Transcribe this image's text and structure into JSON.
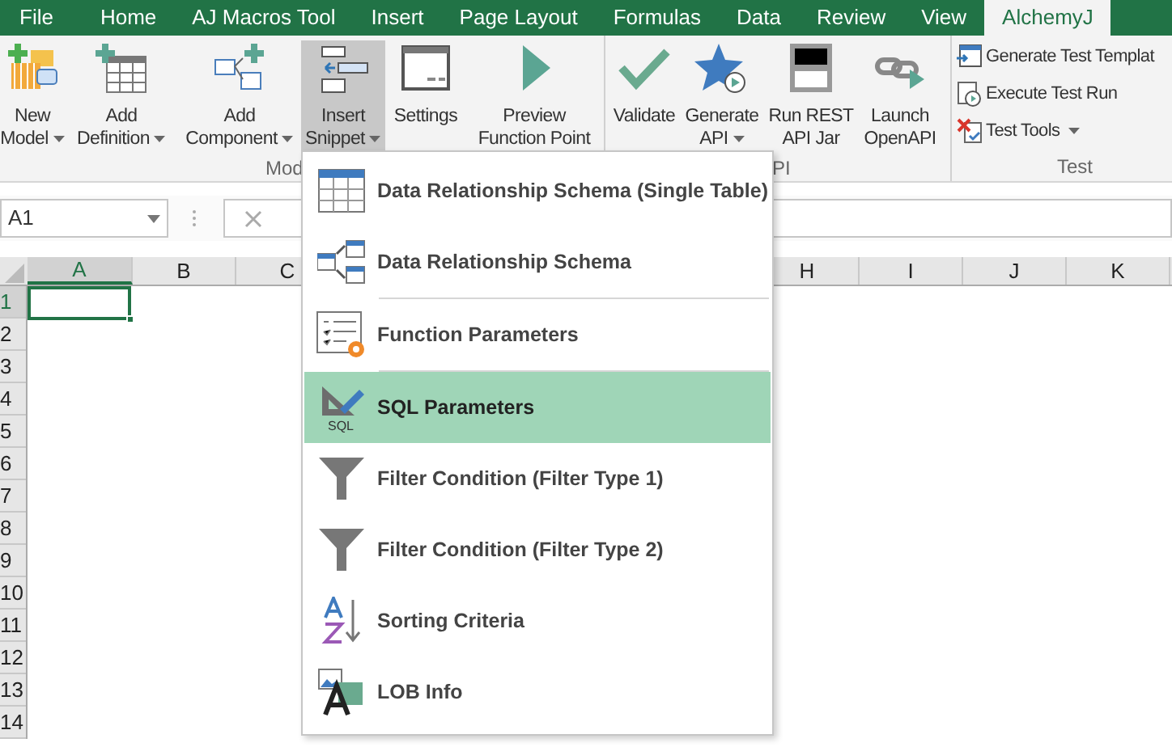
{
  "ribbon_tabs": [
    {
      "label": "File",
      "selected": false
    },
    {
      "label": "Home",
      "selected": false
    },
    {
      "label": "AJ Macros Tool",
      "selected": false
    },
    {
      "label": "Insert",
      "selected": false
    },
    {
      "label": "Page Layout",
      "selected": false
    },
    {
      "label": "Formulas",
      "selected": false
    },
    {
      "label": "Data",
      "selected": false
    },
    {
      "label": "Review",
      "selected": false
    },
    {
      "label": "View",
      "selected": false
    },
    {
      "label": "AlchemyJ",
      "selected": true
    }
  ],
  "ribbon_groups": [
    {
      "label": "Mod",
      "buttons": [
        {
          "line1": "New",
          "line2": "Model",
          "dropdown": true,
          "pressed": false
        },
        {
          "line1": "Add",
          "line2": "Definition",
          "dropdown": true,
          "pressed": false
        },
        {
          "line1": "Add",
          "line2": "Component",
          "dropdown": true,
          "pressed": false
        },
        {
          "line1": "Insert",
          "line2": "Snippet",
          "dropdown": true,
          "pressed": true
        },
        {
          "line1": "Settings",
          "dropdown": false,
          "pressed": false
        },
        {
          "line1": "Preview",
          "line2": "Function Point",
          "dropdown": false,
          "pressed": false
        }
      ]
    },
    {
      "label": "PI",
      "buttons": [
        {
          "line1": "Validate",
          "dropdown": false,
          "pressed": false
        },
        {
          "line1": "Generate",
          "line2": "API",
          "dropdown": true,
          "pressed": false
        },
        {
          "line1": "Run REST",
          "line2": "API Jar",
          "dropdown": false,
          "pressed": false
        },
        {
          "line1": "Launch",
          "line2": "OpenAPI",
          "dropdown": false,
          "pressed": false
        }
      ]
    },
    {
      "label": "Test",
      "small_buttons": [
        {
          "label": "Generate Test Templat",
          "dropdown": false
        },
        {
          "label": "Execute Test Run",
          "dropdown": false
        },
        {
          "label": "Test Tools",
          "dropdown": true
        }
      ]
    }
  ],
  "name_box": "A1",
  "columns": [
    {
      "label": "A",
      "selected": true
    },
    {
      "label": "B",
      "selected": false
    },
    {
      "label": "C",
      "selected": false
    },
    {
      "label": "H",
      "selected": false
    },
    {
      "label": "I",
      "selected": false
    },
    {
      "label": "J",
      "selected": false
    },
    {
      "label": "K",
      "selected": false
    }
  ],
  "rows": [
    {
      "label": "1",
      "selected": true
    },
    {
      "label": "2",
      "selected": false
    },
    {
      "label": "3",
      "selected": false
    },
    {
      "label": "4",
      "selected": false
    },
    {
      "label": "5",
      "selected": false
    },
    {
      "label": "6",
      "selected": false
    },
    {
      "label": "7",
      "selected": false
    },
    {
      "label": "8",
      "selected": false
    },
    {
      "label": "9",
      "selected": false
    },
    {
      "label": "10",
      "selected": false
    },
    {
      "label": "11",
      "selected": false
    },
    {
      "label": "12",
      "selected": false
    },
    {
      "label": "13",
      "selected": false
    },
    {
      "label": "14",
      "selected": false
    }
  ],
  "snippet_menu": [
    {
      "label": "Data Relationship Schema (Single Table)",
      "selected": false,
      "divider_before": false
    },
    {
      "label": "Data Relationship Schema",
      "selected": false,
      "divider_before": false
    },
    {
      "label": "Function Parameters",
      "selected": false,
      "divider_before": true
    },
    {
      "label": "SQL Parameters",
      "selected": true,
      "divider_before": true,
      "icon_caption": "SQL"
    },
    {
      "label": "Filter Condition (Filter Type 1)",
      "selected": false,
      "divider_before": false
    },
    {
      "label": "Filter Condition (Filter Type 2)",
      "selected": false,
      "divider_before": false
    },
    {
      "label": "Sorting Criteria",
      "selected": false,
      "divider_before": false
    },
    {
      "label": "LOB Info",
      "selected": false,
      "divider_before": false
    }
  ]
}
